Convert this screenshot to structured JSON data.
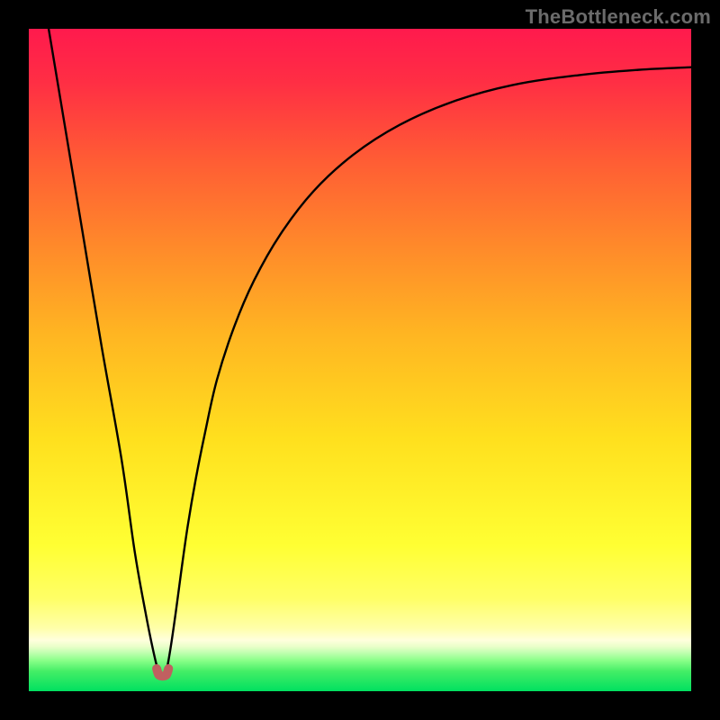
{
  "attribution": "TheBottleneck.com",
  "chart_data": {
    "type": "line",
    "title": "",
    "xlabel": "",
    "ylabel": "",
    "xlim": [
      0,
      100
    ],
    "ylim": [
      0,
      100
    ],
    "grid": false,
    "series": [
      {
        "name": "bottleneck-curve",
        "x": [
          3,
          5,
          8,
          11,
          14,
          16,
          17.6,
          18.7,
          19.5,
          20,
          20.4,
          20.8,
          21.4,
          22.2,
          23,
          24,
          25.2,
          26.6,
          28.4,
          31,
          34,
          38,
          43,
          49,
          56,
          64,
          73,
          83,
          92,
          100
        ],
        "y": [
          100,
          88,
          70,
          52,
          35,
          21,
          12,
          6.5,
          3.2,
          2.4,
          2.4,
          3.2,
          6.5,
          12,
          18,
          25,
          32,
          39,
          47,
          55,
          62,
          69,
          75.5,
          81,
          85.5,
          89,
          91.5,
          93,
          93.8,
          94.2
        ]
      },
      {
        "name": "minimum-marker",
        "x": [
          19.3,
          19.6,
          20.0,
          20.4,
          20.8,
          21.1
        ],
        "y": [
          3.4,
          2.5,
          2.3,
          2.3,
          2.5,
          3.4
        ]
      }
    ],
    "gradient_stops": [
      {
        "pos": 0.0,
        "color": "#ff1a4d"
      },
      {
        "pos": 0.08,
        "color": "#ff2e44"
      },
      {
        "pos": 0.2,
        "color": "#ff5d34"
      },
      {
        "pos": 0.33,
        "color": "#ff8a2a"
      },
      {
        "pos": 0.46,
        "color": "#ffb522"
      },
      {
        "pos": 0.62,
        "color": "#ffe01e"
      },
      {
        "pos": 0.78,
        "color": "#ffff33"
      },
      {
        "pos": 0.86,
        "color": "#ffff66"
      },
      {
        "pos": 0.905,
        "color": "#ffffaa"
      },
      {
        "pos": 0.923,
        "color": "#ffffdd"
      },
      {
        "pos": 0.933,
        "color": "#e8ffc8"
      },
      {
        "pos": 0.942,
        "color": "#c0ffb0"
      },
      {
        "pos": 0.954,
        "color": "#88ff88"
      },
      {
        "pos": 0.97,
        "color": "#44ee66"
      },
      {
        "pos": 1.0,
        "color": "#00e060"
      }
    ]
  }
}
